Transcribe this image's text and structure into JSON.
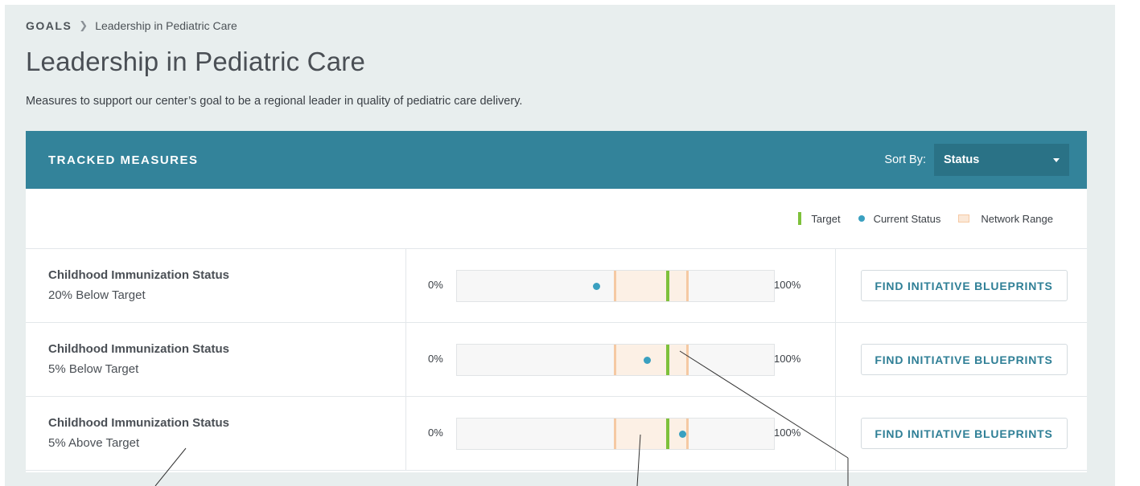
{
  "breadcrumb": {
    "root": "GOALS",
    "separator": ">",
    "current": "Leadership in Pediatric Care"
  },
  "page": {
    "title": "Leadership in Pediatric Care",
    "description": "Measures to support our center’s goal to be a regional leader in quality of pediatric care delivery."
  },
  "panel": {
    "title": "TRACKED MEASURES",
    "sort_label": "Sort By:",
    "sort_value": "Status"
  },
  "legend": {
    "target": "Target",
    "current_status": "Current Status",
    "network_range": "Network Range"
  },
  "colors": {
    "header": "#33839a",
    "target": "#7ec13b",
    "current_status": "#3aa0c0",
    "network_range": "#fcf0e5"
  },
  "measures": [
    {
      "name": "Childhood Immunization Status",
      "status": "20% Below Target",
      "min_label": "0%",
      "max_label": "100%",
      "current": 0.44,
      "target": 0.665,
      "range_low": 0.495,
      "range_high": 0.73,
      "action": "FIND INITIATIVE BLUEPRINTS"
    },
    {
      "name": "Childhood Immunization Status",
      "status": "5% Below Target",
      "min_label": "0%",
      "max_label": "100%",
      "current": 0.6,
      "target": 0.665,
      "range_low": 0.495,
      "range_high": 0.73,
      "action": "FIND INITIATIVE BLUEPRINTS"
    },
    {
      "name": "Childhood Immunization Status",
      "status": "5% Above Target",
      "min_label": "0%",
      "max_label": "100%",
      "current": 0.71,
      "target": 0.665,
      "range_low": 0.495,
      "range_high": 0.73,
      "action": "FIND INITIATIVE BLUEPRINTS"
    }
  ]
}
